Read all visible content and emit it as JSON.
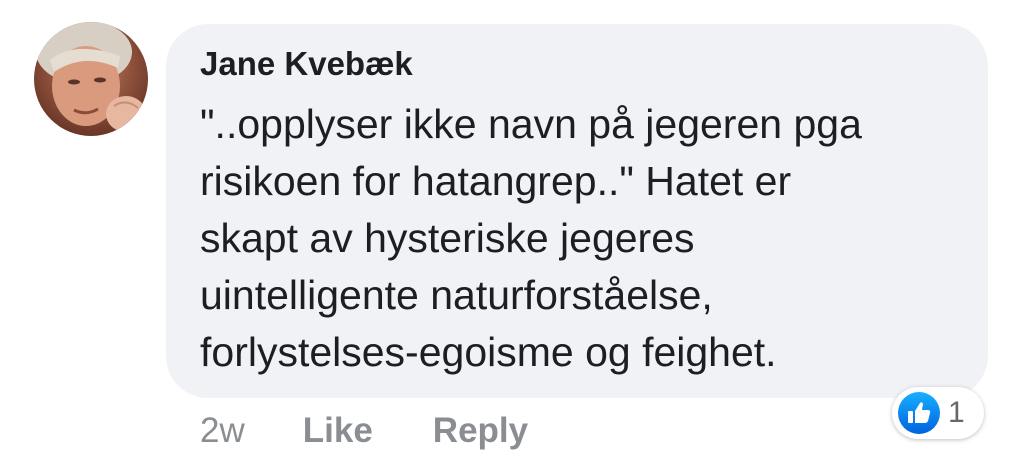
{
  "comment": {
    "author": "Jane Kvebæk",
    "text_lines": [
      "\"..opplyser ikke navn på jegeren pga",
      "risikoen for hatangrep..\" Hatet er",
      "skapt av hysteriske jegeres",
      "uintelligente naturforståelse,",
      "forlystelses-egoisme og feighet."
    ],
    "timestamp": "2w",
    "like_label": "Like",
    "reply_label": "Reply",
    "reaction_count": "1",
    "reaction_icon": "thumbs-up-icon"
  },
  "colors": {
    "bubble": "#f0f2f5",
    "text": "#1c1e21",
    "meta": "#8a8d91",
    "like_blue": "#1877f2"
  }
}
